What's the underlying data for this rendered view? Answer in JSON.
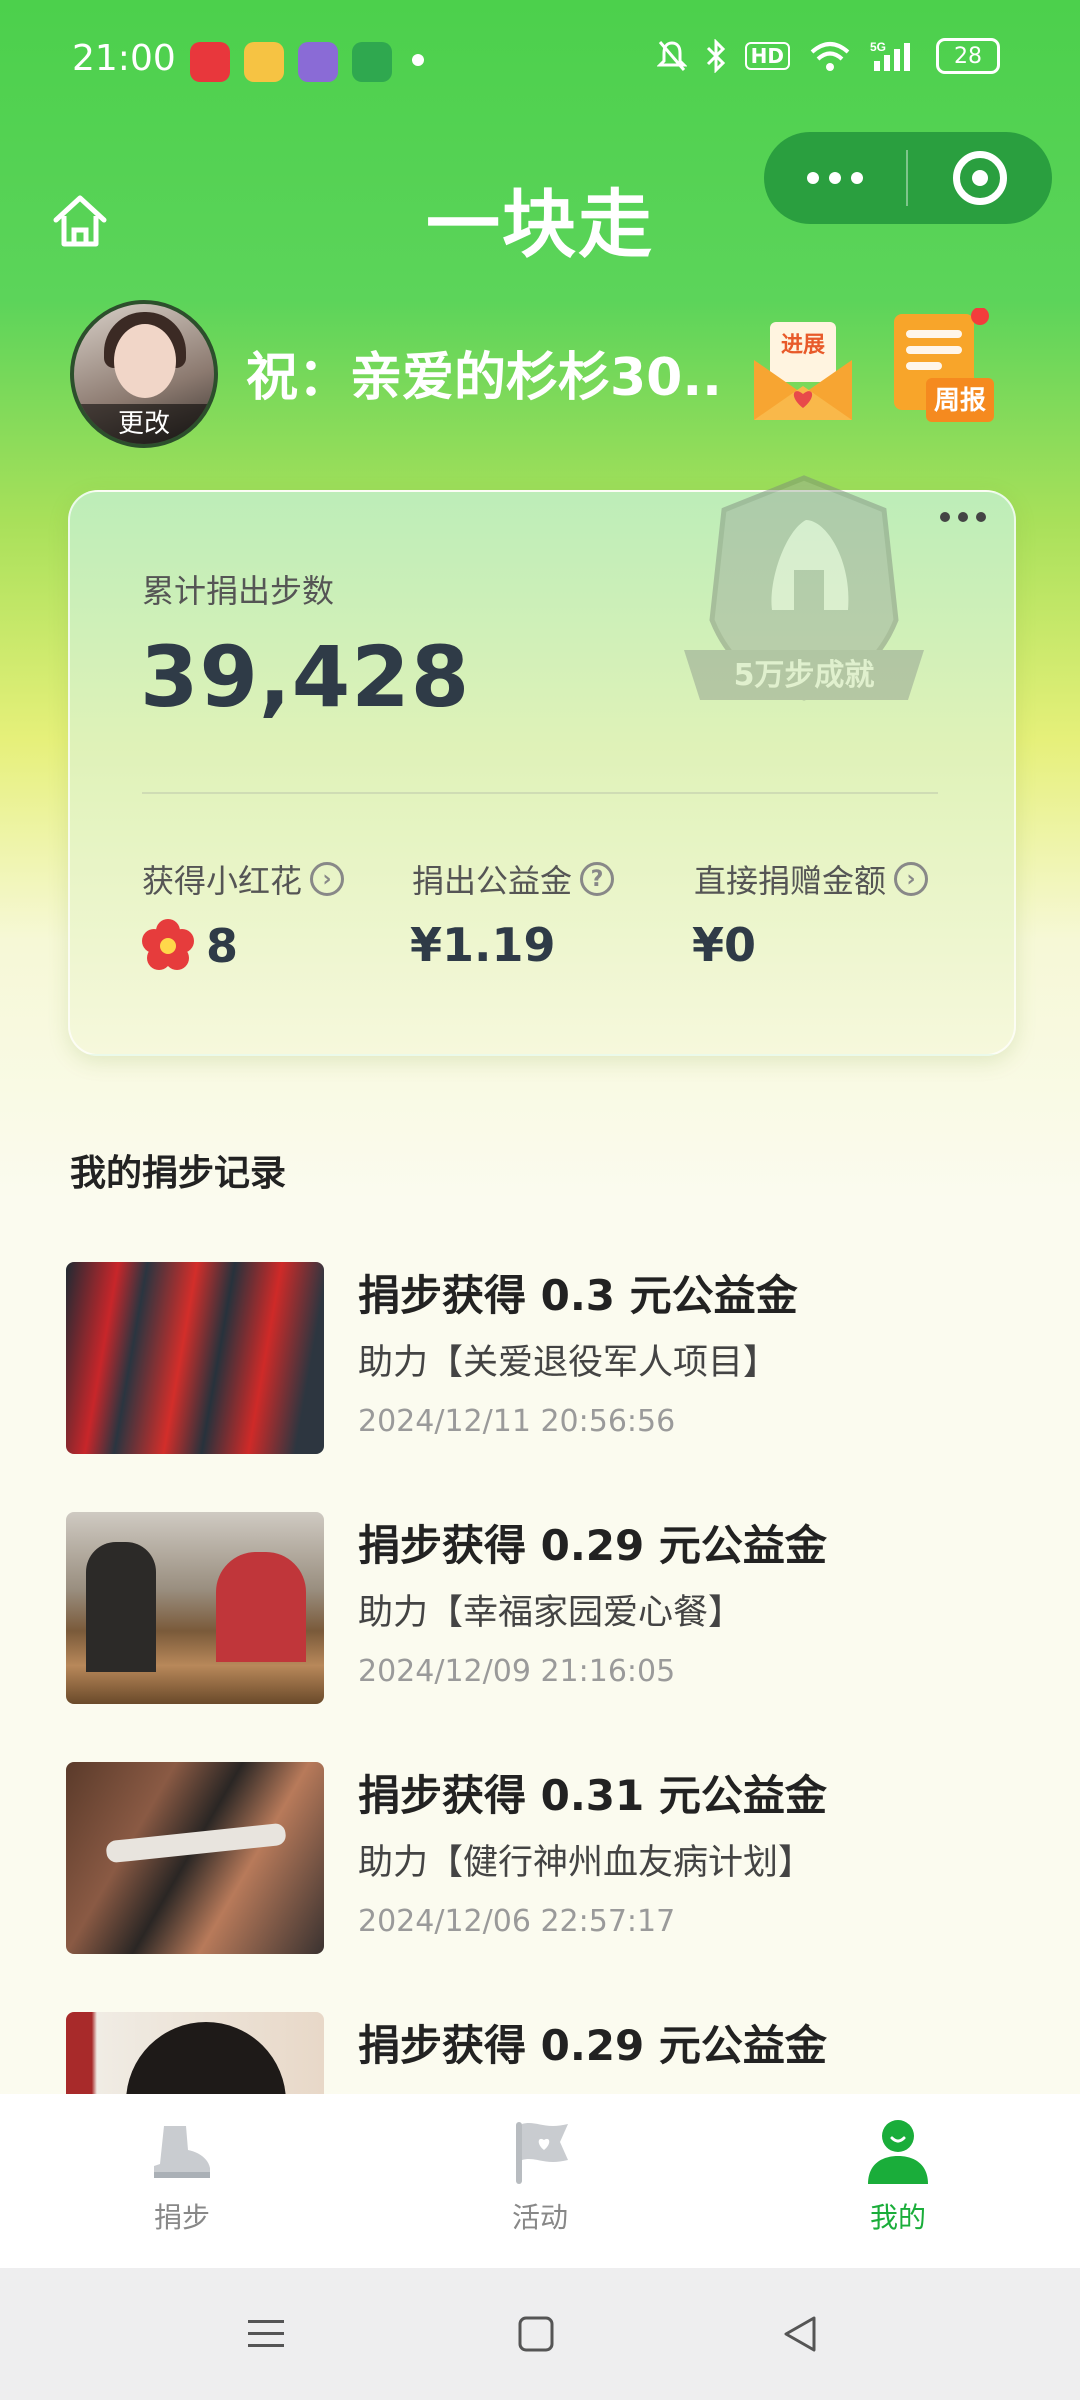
{
  "status_bar": {
    "time": "21:00",
    "battery": "28",
    "icons": [
      "app-icon-red",
      "weibo-icon",
      "app-icon-purple",
      "message-icon",
      "mute-icon",
      "bluetooth-icon",
      "hd-icon",
      "wifi-icon",
      "signal-5g-icon",
      "battery-icon"
    ]
  },
  "header": {
    "title": "一块走",
    "home_icon": "home-icon",
    "more_icon": "more-dots-icon",
    "close_icon": "target-close-icon"
  },
  "user": {
    "avatar_change_label": "更改",
    "greeting": "祝：亲爱的杉杉30..",
    "progress_label": "进展",
    "weekly_label": "周报"
  },
  "stats": {
    "total_label": "累计捐出步数",
    "total_value": "39,428",
    "badge_label": "5万步成就",
    "flowers_label": "获得小红花",
    "flowers_value": "8",
    "fund_label": "捐出公益金",
    "fund_value": "¥1.19",
    "direct_label": "直接捐赠金额",
    "direct_value": "¥0",
    "help_glyph": "?"
  },
  "records": {
    "section_title": "我的捐步记录",
    "items": [
      {
        "title": "捐步获得 0.3 元公益金",
        "project": "助力【关爱退役军人项目】",
        "time": "2024/12/11 20:56:56"
      },
      {
        "title": "捐步获得 0.29 元公益金",
        "project": "助力【幸福家园爱心餐】",
        "time": "2024/12/09 21:16:05"
      },
      {
        "title": "捐步获得 0.31 元公益金",
        "project": "助力【健行神州血友病计划】",
        "time": "2024/12/06 22:57:17"
      },
      {
        "title": "捐步获得 0.29 元公益金",
        "project": "",
        "time": ""
      }
    ]
  },
  "tabbar": {
    "tabs": [
      {
        "label": "捐步",
        "icon": "shoe-icon",
        "active": false
      },
      {
        "label": "活动",
        "icon": "flag-heart-icon",
        "active": false
      },
      {
        "label": "我的",
        "icon": "user-icon",
        "active": true
      }
    ],
    "active_color": "#1aad3a"
  },
  "colors": {
    "brand_green": "#2a9f3f",
    "text_dark": "#2f3b47"
  }
}
